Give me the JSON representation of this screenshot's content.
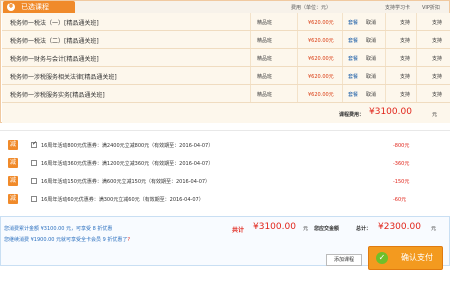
{
  "tab": {
    "icon": "cart-icon",
    "label": "已选课程"
  },
  "headers": {
    "price": "费用（单位：元）",
    "card": "支持学习卡",
    "ticket": "VIP折扣"
  },
  "courses": [
    {
      "name": "税务师一税法（一）[精品通关班]",
      "class": "精品班",
      "price": "¥620.00元",
      "add": "套餐",
      "cancel": "取消",
      "card": "支持",
      "ticket": "支持"
    },
    {
      "name": "税务师一税法（二）[精品通关班]",
      "class": "精品班",
      "price": "¥620.00元",
      "add": "套餐",
      "cancel": "取消",
      "card": "支持",
      "ticket": "支持"
    },
    {
      "name": "税务师一财务与会计[精品通关班]",
      "class": "精品班",
      "price": "¥620.00元",
      "add": "套餐",
      "cancel": "取消",
      "card": "支持",
      "ticket": "支持"
    },
    {
      "name": "税务师一涉税服务相关法律[精品通关班]",
      "class": "精品班",
      "price": "¥620.00元",
      "add": "套餐",
      "cancel": "取消",
      "card": "支持",
      "ticket": "支持"
    },
    {
      "name": "税务师一涉税服务实务[精品通关班]",
      "class": "精品班",
      "price": "¥620.00元",
      "add": "套餐",
      "cancel": "取消",
      "card": "支持",
      "ticket": "支持"
    }
  ],
  "course_total": {
    "label": "课程费用：",
    "value": "¥3100.00",
    "unit": "元"
  },
  "coupons": [
    {
      "badge": "减",
      "checked": true,
      "text": "16周年活动800元优惠券：满2400元立减800元（有效期至：2016-04-07）",
      "amount": "-800元"
    },
    {
      "badge": "减",
      "checked": false,
      "text": "16周年活动360元优惠券：满1200元立减360元（有效期至：2016-04-07）",
      "amount": "-360元"
    },
    {
      "badge": "减",
      "checked": false,
      "text": "16周年活动150元优惠券：满600元立减150元（有效期至：2016-04-07）",
      "amount": "-150元"
    },
    {
      "badge": "减",
      "checked": false,
      "text": "16周年活动60元优惠券：满300元立减60元（有效期至：2016-04-07）",
      "amount": "-60元"
    }
  ],
  "summary": {
    "line1": "您消费累计金额 ¥3100.00 元，可享受 8 折优惠",
    "line2_text": "您继续消费 ¥1900.00 元就可享受全卡会员 9 折优惠了",
    "line2_link": "?"
  },
  "grand_total": {
    "label": "共计",
    "value": "¥3100.00",
    "unit": "元"
  },
  "pay": {
    "label": "您应交金额",
    "total_label": "总计：",
    "value": "¥2300.00",
    "unit": "元"
  },
  "buttons": {
    "add_course": "添加课程",
    "pay": "确认支付",
    "pay_icon": "check-icon"
  },
  "colors": {
    "accent": "#f08a2a",
    "price": "#e1251b",
    "link": "#1d5fa8"
  }
}
